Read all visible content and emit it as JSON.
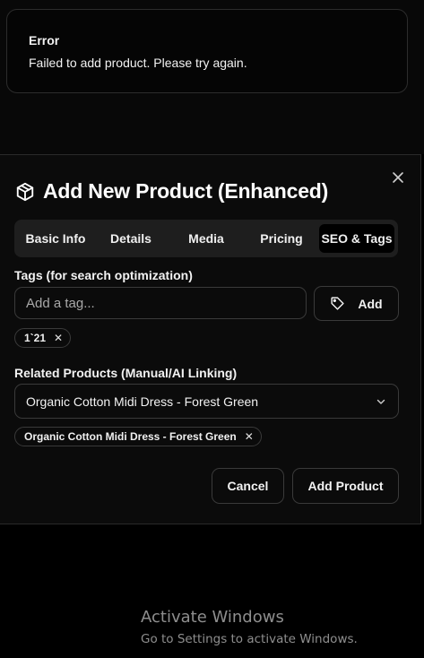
{
  "toast": {
    "title": "Error",
    "message": "Failed to add product. Please try again."
  },
  "dialog": {
    "title": "Add New Product (Enhanced)",
    "title_icon": "package-icon",
    "close_icon": "close-icon",
    "tabs": [
      {
        "label": "Basic Info",
        "active": false
      },
      {
        "label": "Details",
        "active": false
      },
      {
        "label": "Media",
        "active": false
      },
      {
        "label": "Pricing",
        "active": false
      },
      {
        "label": "SEO & Tags",
        "active": true
      }
    ],
    "tags": {
      "label": "Tags (for search optimization)",
      "placeholder": "Add a tag...",
      "value": "",
      "add_button": "Add",
      "add_icon": "tag-icon",
      "chips": [
        {
          "label": "1`21"
        }
      ]
    },
    "related": {
      "label": "Related Products (Manual/AI Linking)",
      "selected": "Organic Cotton Midi Dress - Forest Green",
      "chips": [
        {
          "label": "Organic Cotton Midi Dress - Forest Green"
        }
      ]
    },
    "footer": {
      "cancel": "Cancel",
      "submit": "Add Product"
    }
  },
  "watermark": {
    "title": "Activate Windows",
    "subtitle": "Go to Settings to activate Windows."
  },
  "colors": {
    "background": "#000000",
    "dialog": "#0b0b0b",
    "border": "#3a3a3a",
    "tabs_bg": "#1e1e1e"
  }
}
